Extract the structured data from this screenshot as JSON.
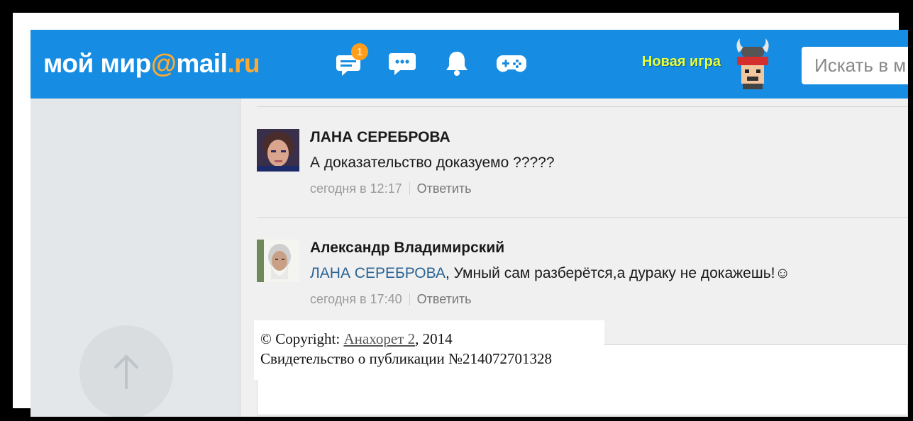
{
  "header": {
    "logo_main": "мой мир",
    "logo_at": "@",
    "logo_mail": "mail",
    "logo_dot": ".",
    "logo_ru": "ru",
    "messages_badge": "1",
    "new_game_label": "Новая игра",
    "search_placeholder": "Искать в м",
    "icons": [
      "messages-icon",
      "chat-icon",
      "bell-icon",
      "gamepad-icon"
    ]
  },
  "comments": [
    {
      "author": "ЛАНА СЕРЕБРОВА",
      "text": "А доказательство доказуемо ?????",
      "time": "сегодня в 12:17",
      "reply": "Ответить"
    },
    {
      "author": "Александр Владимирский",
      "mention": "ЛАНА СЕРЕБРОВА",
      "text": ", Умный сам разберётся,а дураку не докажешь!☺",
      "time": "сегодня в 17:40",
      "reply": "Ответить"
    }
  ],
  "copyright": {
    "prefix": "© Copyright: ",
    "author_link": "Анахорет 2",
    "year": ", 2014",
    "certificate": "Свидетельство о публикации №214072701328"
  },
  "colors": {
    "header_bg": "#168de2",
    "logo_accent": "#ffa930",
    "badge": "#ff9e1c",
    "new_game": "#e8ff3b",
    "link": "#2a6496"
  }
}
